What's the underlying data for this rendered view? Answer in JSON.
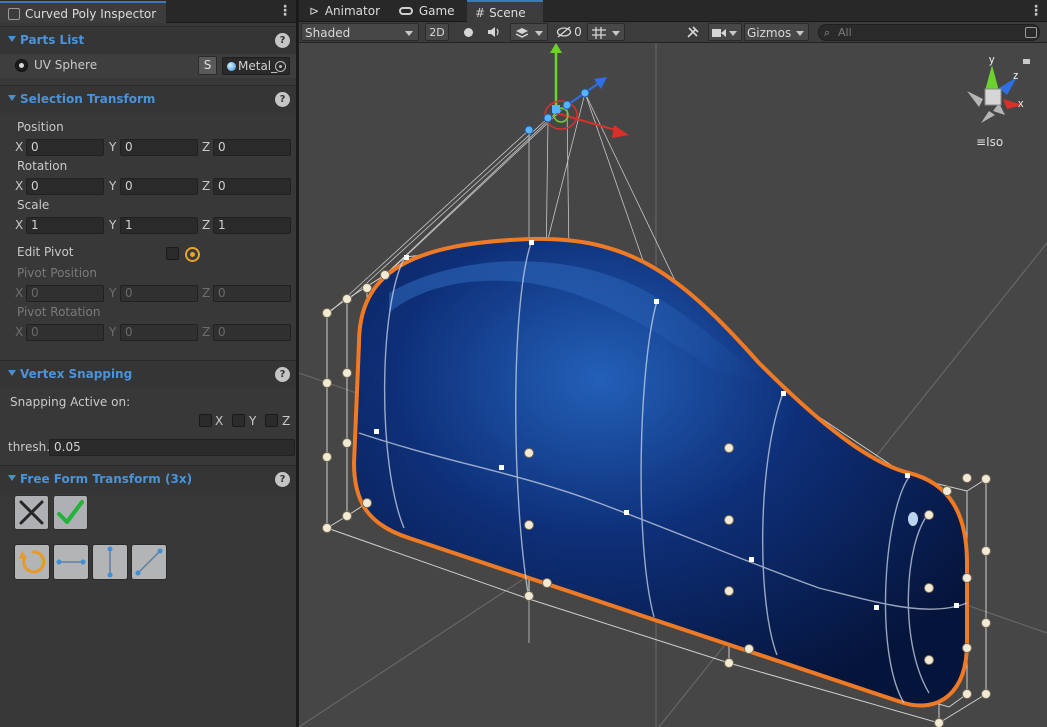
{
  "inspector": {
    "tab_title": "Curved Poly Inspector",
    "parts_list": {
      "title": "Parts List",
      "item_label": "UV Sphere",
      "s_button": "S",
      "material": "Metal_"
    },
    "selection_transform": {
      "title": "Selection Transform",
      "position_label": "Position",
      "rotation_label": "Rotation",
      "scale_label": "Scale",
      "axis_x": "X",
      "axis_y": "Y",
      "axis_z": "Z",
      "position": {
        "x": "0",
        "y": "0",
        "z": "0"
      },
      "rotation": {
        "x": "0",
        "y": "0",
        "z": "0"
      },
      "scale": {
        "x": "1",
        "y": "1",
        "z": "1"
      },
      "edit_pivot_label": "Edit Pivot",
      "pivot_position_label": "Pivot Position",
      "pivot_rotation_label": "Pivot Rotation",
      "pivot_position": {
        "x": "0",
        "y": "0",
        "z": "0"
      },
      "pivot_rotation": {
        "x": "0",
        "y": "0",
        "z": "0"
      }
    },
    "vertex_snapping": {
      "title": "Vertex Snapping",
      "snapping_label": "Snapping Active on:",
      "x_label": "X",
      "y_label": "Y",
      "z_label": "Z",
      "thresh_label": "thresh.",
      "thresh_value": "0.05"
    },
    "free_form": {
      "title": "Free Form Transform (3x)"
    }
  },
  "scene": {
    "tabs": [
      {
        "label": "Animator",
        "icon": "animator-icon"
      },
      {
        "label": "Game",
        "icon": "gamepad-icon"
      },
      {
        "label": "Scene",
        "icon": "hash-icon"
      }
    ],
    "toolbar": {
      "shading_mode": "Shaded",
      "mode_2d": "2D",
      "hidden_count": "0",
      "gizmos": "Gizmos",
      "search_placeholder": "All"
    },
    "orientation": {
      "y": "y",
      "z": "z",
      "x": "x",
      "projection": "Iso"
    }
  },
  "colors": {
    "accent_blue": "#4a93d9",
    "selection_orange": "#f07a24",
    "mesh_blue": "#0c2f7a",
    "axis_x": "#d9302a",
    "axis_y": "#6bd22e",
    "axis_z": "#2f6fe6"
  }
}
